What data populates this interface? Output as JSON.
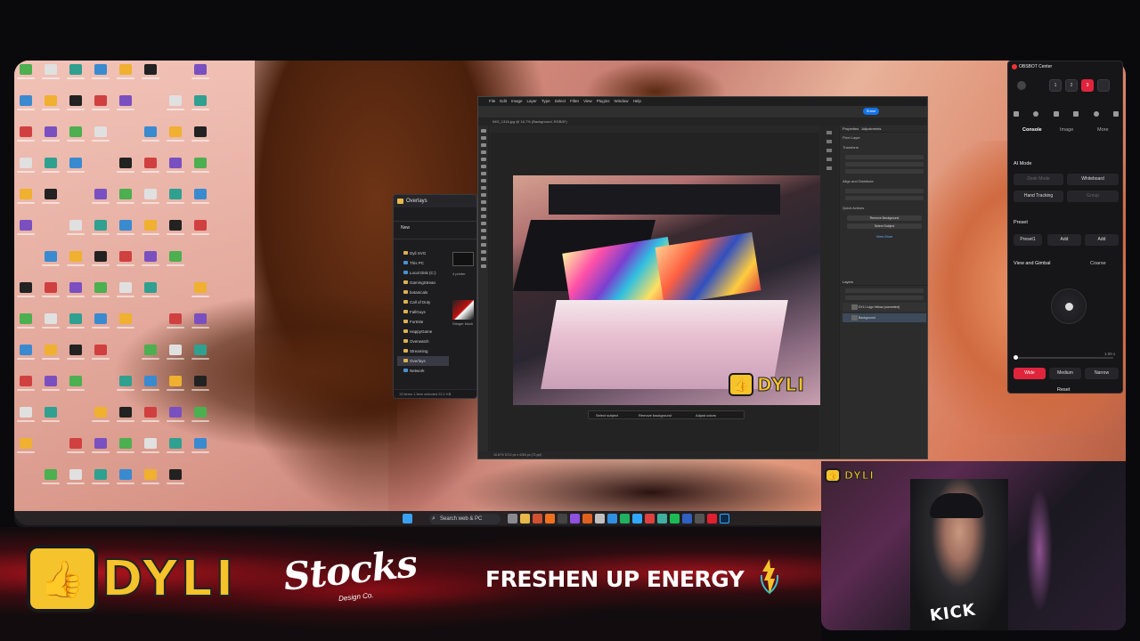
{
  "photoshop": {
    "menu": [
      "File",
      "Edit",
      "Image",
      "Layer",
      "Type",
      "Select",
      "Filter",
      "View",
      "Plugins",
      "Window",
      "Help"
    ],
    "share_label": "Share",
    "doc_tab": "IMG_1316.jpg @ 16.7% (Background, RGB/8*)",
    "context_bar": {
      "select_subject": "Select subject",
      "remove_background": "Remove background",
      "adjust_colors": "Adjust colors"
    },
    "panels": {
      "tabs": [
        "Properties",
        "Adjustments"
      ],
      "pixel_layer": "Pixel Layer",
      "transform": "Transform",
      "align": "Align and Distribute",
      "quick_actions": "Quick Actions",
      "remove_bg": "Remove Background",
      "select_subject": "Select Subject",
      "view_more": "View More",
      "layers": "Layers"
    },
    "layers": [
      "DYLI Logo Yellow (converted)",
      "Background"
    ],
    "status": "16.67%   5712 px x 4284 px (72 ppi)"
  },
  "explorer": {
    "title": "Overlays",
    "new_label": "New",
    "tree": [
      "Dyli SVG",
      "This PC",
      "Local Disk (C:)",
      "GamingStrean",
      "botanicals",
      "Call of Duty",
      "FallGuys",
      "Fortnite",
      "HappyGame",
      "Overwatch",
      "Streaming",
      "Overlays",
      "Network"
    ],
    "preview_labels": [
      "4 printer",
      "Stinger block"
    ],
    "status": "13 items   1 item selected  22.1 KB"
  },
  "taskbar": {
    "search_placeholder": "Search web & PC"
  },
  "obsbot": {
    "title": "OBSBOT Center",
    "presets": [
      "1",
      "2",
      "3"
    ],
    "tabs": {
      "console": "Console",
      "image": "Image",
      "more": "More"
    },
    "ai_mode": "AI Mode",
    "ai_buttons": {
      "desk": "Desk Mode",
      "whiteboard": "Whiteboard",
      "hand": "Hand Tracking",
      "group": "Group"
    },
    "preset_label": "Preset",
    "preset_select": "Preset1",
    "add": "Add",
    "gimbal": "View and Gimbal",
    "coarse": "Coarse",
    "zoom": "1.00 x",
    "fov": {
      "wide": "Wide",
      "medium": "Medium",
      "narrow": "Narrow"
    },
    "reset": "Reset"
  },
  "banner": {
    "dyli": "DYLI",
    "stocks": "Stocks",
    "stocks_sub": "Design Co.",
    "fresh": "FRESHEN UP ENERGY"
  },
  "webcam": {
    "shirt": "KICK",
    "badge": "DYLI"
  },
  "photo_badge": "DYLI",
  "colors": {
    "accent_red": "#e0243c",
    "dyli_yellow": "#f5c32c",
    "ps_blue": "#1473e6"
  }
}
